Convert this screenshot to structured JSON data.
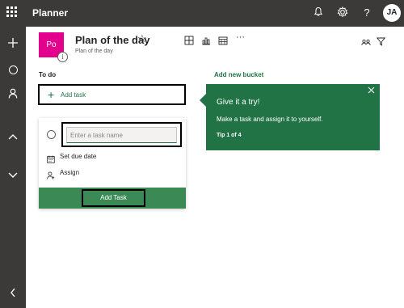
{
  "topbar": {
    "app_title": "Planner",
    "icons": [
      "waffle-icon",
      "bell-icon",
      "gear-icon",
      "help-icon"
    ],
    "help_glyph": "?",
    "avatar_initials": "JA"
  },
  "rail": {
    "icons": [
      "plus-icon",
      "circle-icon",
      "person-icon",
      "chevron-up-icon",
      "chevron-down-icon",
      "chevron-left-icon"
    ]
  },
  "plan": {
    "tile_initials": "Po",
    "name": "Plan of the day",
    "subtitle": "Plan of the day",
    "info_glyph": "i",
    "tile_color": "#e3008c"
  },
  "toolbar": {
    "more_glyph": "···"
  },
  "bucket": {
    "title": "To do",
    "add_task_label": "Add task",
    "add_new_bucket": "Add new bucket"
  },
  "task_card": {
    "name_placeholder": "Enter a task name",
    "due_date_label": "Set due date",
    "assign_label": "Assign",
    "add_button_label": "Add Task"
  },
  "teaching_bubble": {
    "title": "Give it a try!",
    "body": "Make a task and assign it to yourself.",
    "tip": "Tip 1 of 4"
  },
  "colors": {
    "accent": "#217346",
    "topbar": "#3b3a39"
  }
}
